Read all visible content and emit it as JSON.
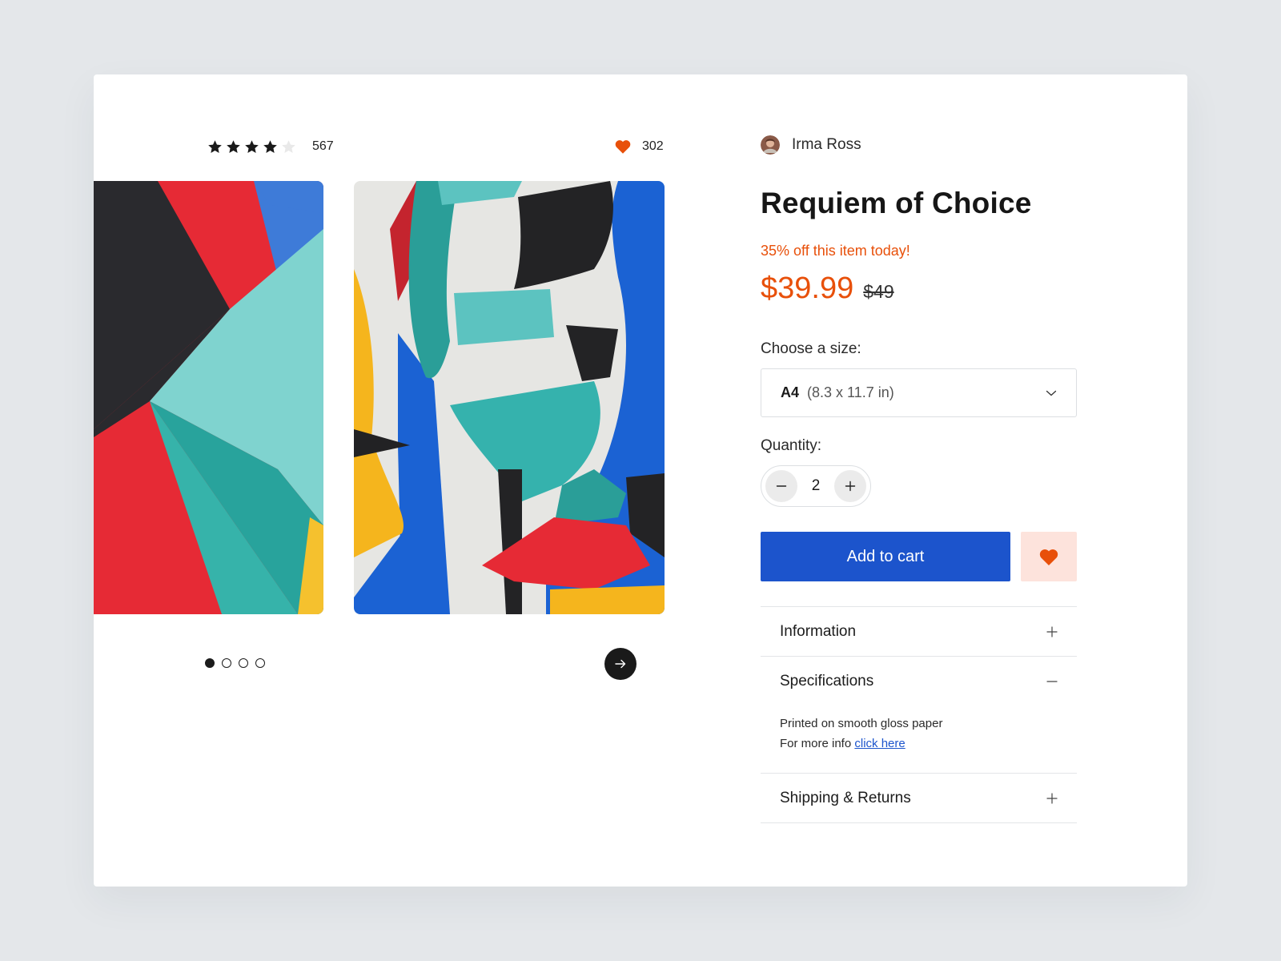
{
  "product": {
    "rating": 4,
    "rating_max": 5,
    "rating_count": "567",
    "likes_count": "302",
    "artist_name": "Irma Ross",
    "title": "Requiem of Choice",
    "promo_text": "35% off this item today!",
    "price": "$39.99",
    "original_price": "$49"
  },
  "gallery": {
    "slide_count": 4,
    "active_index": 0
  },
  "size": {
    "label": "Choose a size:",
    "selected_code": "A4",
    "selected_dims": "(8.3 x 11.7 in)"
  },
  "quantity": {
    "label": "Quantity:",
    "value": "2"
  },
  "actions": {
    "add_to_cart": "Add to cart"
  },
  "accordion": {
    "information": "Information",
    "specifications": "Specifications",
    "spec_text": "Printed on smooth gloss paper",
    "more_info_prefix": "For more info",
    "more_info_link": "click here",
    "shipping": "Shipping & Returns"
  },
  "icons": {
    "star": "star-icon",
    "heart": "heart-icon",
    "arrow": "arrow-right-icon",
    "chevron": "chevron-down-icon",
    "plus": "plus-icon",
    "minus": "minus-icon"
  },
  "colors": {
    "accent_orange": "#e8500a",
    "primary_blue": "#1c54cc",
    "wishlist_bg": "#fde3dc"
  }
}
